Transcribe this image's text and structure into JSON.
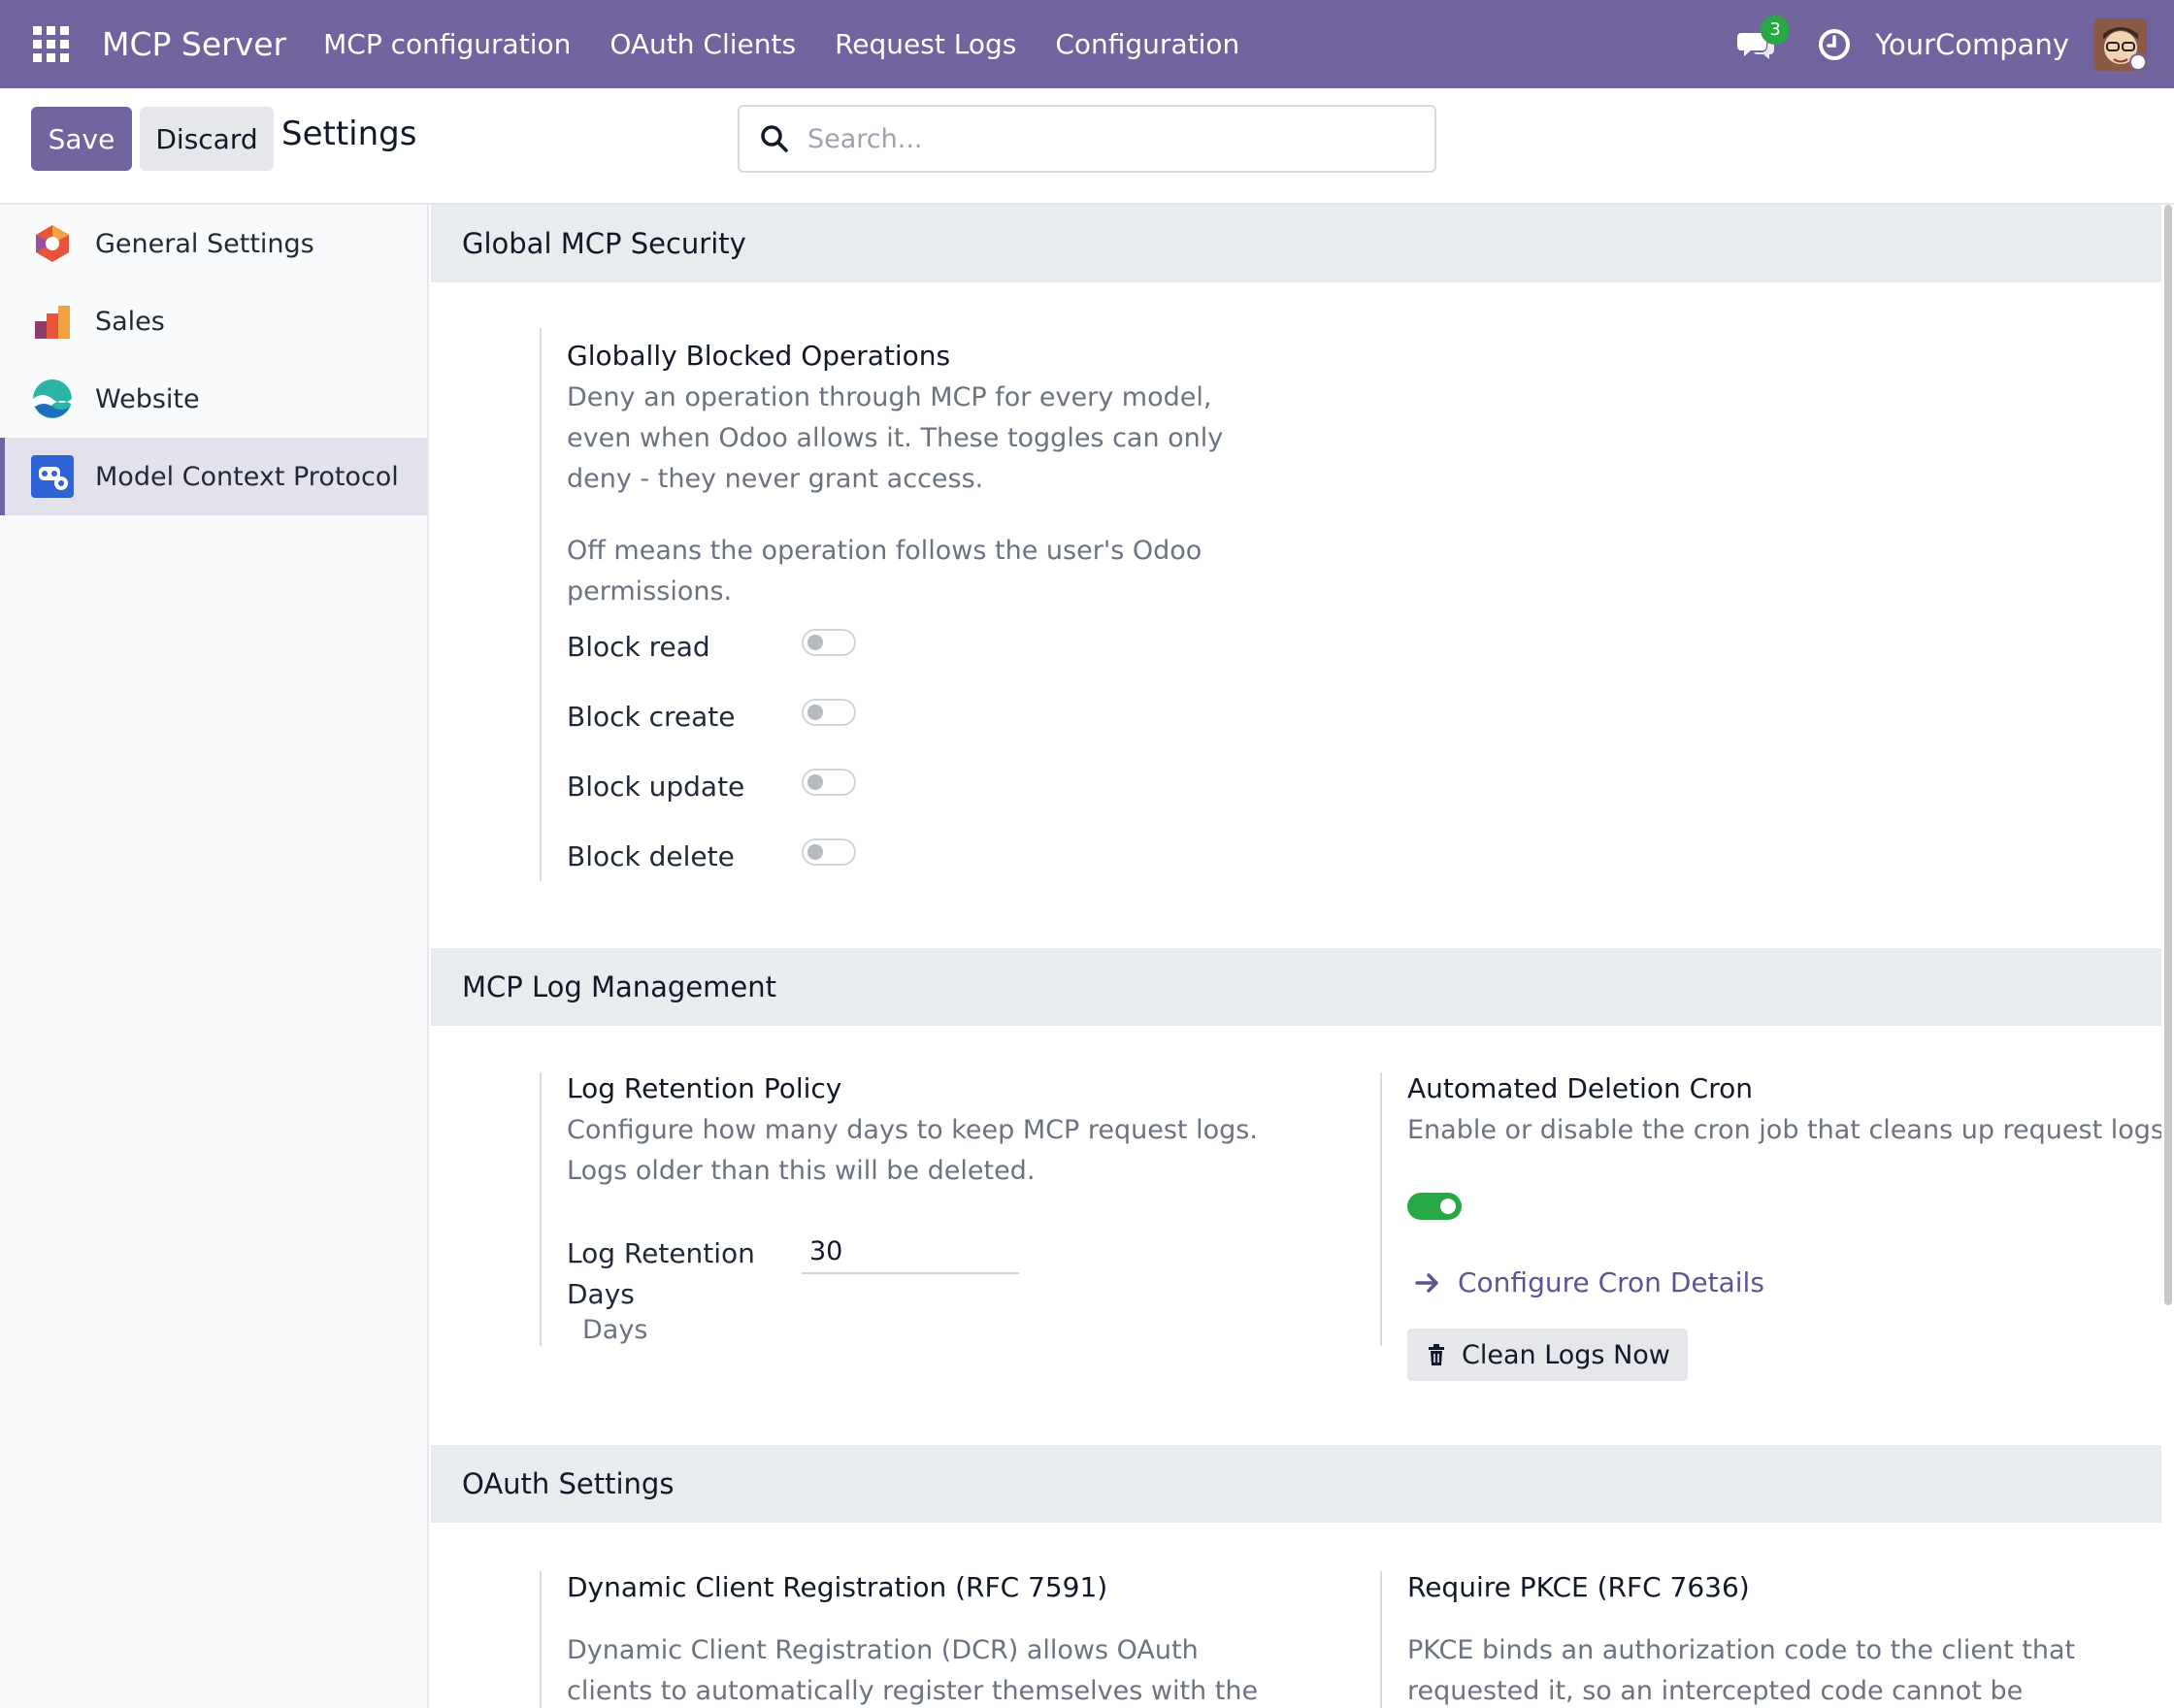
{
  "navbar": {
    "app_name": "MCP Server",
    "menu": [
      "MCP configuration",
      "OAuth Clients",
      "Request Logs",
      "Configuration"
    ],
    "chat_count": "3",
    "company": "YourCompany"
  },
  "toolbar": {
    "save_label": "Save",
    "discard_label": "Discard",
    "title": "Settings",
    "search_placeholder": "Search..."
  },
  "sidebar": {
    "items": [
      {
        "label": "General Settings",
        "icon": "general-settings-icon"
      },
      {
        "label": "Sales",
        "icon": "sales-icon"
      },
      {
        "label": "Website",
        "icon": "website-icon"
      },
      {
        "label": "Model Context Protocol",
        "icon": "mcp-icon",
        "active": true
      }
    ]
  },
  "sections": {
    "security": {
      "header": "Global MCP Security",
      "blocked": {
        "title": "Globally Blocked Operations",
        "desc1": "Deny an operation through MCP for every model, even when Odoo allows it. These toggles can only deny - they never grant access.",
        "desc2": "Off means the operation follows the user's Odoo permissions.",
        "toggles": [
          {
            "label": "Block read",
            "on": false
          },
          {
            "label": "Block create",
            "on": false
          },
          {
            "label": "Block update",
            "on": false
          },
          {
            "label": "Block delete",
            "on": false
          }
        ]
      }
    },
    "logs": {
      "header": "MCP Log Management",
      "retention": {
        "title": "Log Retention Policy",
        "desc": "Configure how many days to keep MCP request logs. Logs older than this will be deleted.",
        "field_label": "Log Retention Days",
        "value": "30",
        "unit": "Days"
      },
      "cron": {
        "title": "Automated Deletion Cron",
        "desc": "Enable or disable the cron job that cleans up request logs.",
        "enabled": true,
        "configure_link": "Configure Cron Details",
        "clean_button": "Clean Logs Now"
      }
    },
    "oauth": {
      "header": "OAuth Settings",
      "dcr": {
        "title": "Dynamic Client Registration (RFC 7591)",
        "desc": "Dynamic Client Registration (DCR) allows OAuth clients to automatically register themselves with the MCP server"
      },
      "pkce": {
        "title": "Require PKCE (RFC 7636)",
        "desc": "PKCE binds an authorization code to the client that requested it, so an intercepted code cannot be exchanged"
      }
    }
  },
  "colors": {
    "brand": "#71639e",
    "toggle_on": "#28a745",
    "link": "#5f5392"
  }
}
